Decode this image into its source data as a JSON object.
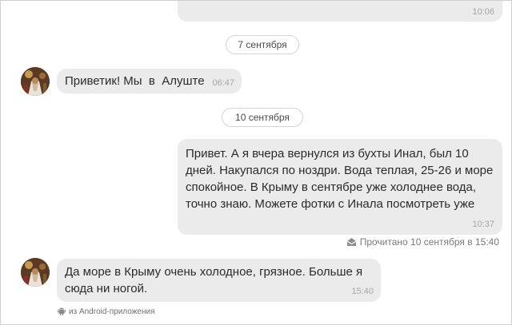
{
  "messages": [
    {
      "text": "",
      "time": "10:06"
    },
    {
      "text": "Приветик! Мы  в  Алуште",
      "time": "06:47"
    },
    {
      "lines": [
        "Привет. А я вчера вернулся из бухты Инал, был 10",
        "дней. Накупался по ноздри. Вода теплая, 25-26 и море",
        "спокойное. В Крыму в сентябре уже холоднее вода,",
        "точно знаю. Можете фотки с Инала посмотреть уже"
      ],
      "time": "10:37"
    },
    {
      "lines": [
        "Да море в Крыму очень холодное, грязное. Больше я",
        "сюда ни ногой."
      ],
      "time": "15:40"
    }
  ],
  "dates": [
    "7 сентября",
    "10 сентября"
  ],
  "read_status": "Прочитано 10 сентября в 15:40",
  "source": "из Android-приложения",
  "icons": {
    "read": "envelope-open-icon",
    "source": "android-icon"
  }
}
